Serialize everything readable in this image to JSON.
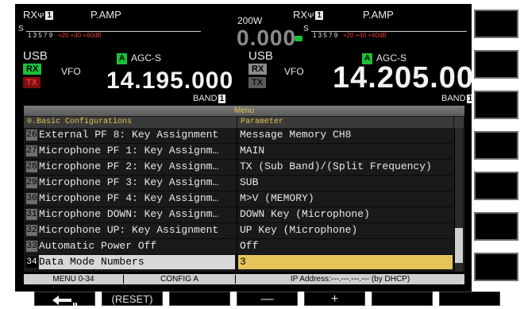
{
  "main": {
    "rx_label": "RX",
    "rx_num": "1",
    "pamp": "P.AMP",
    "s_label": "S",
    "scale_nums": "1  3  5  7  9",
    "scale_red": "+20  +40 +60dB",
    "mode": "USB",
    "rx_badge": "RX",
    "tx_badge": "TX",
    "vfo": "VFO",
    "agc_letter": "A",
    "agc": "AGC-S",
    "frequency": "14.195.000",
    "band_label": "BAND",
    "band_num": "1"
  },
  "sub": {
    "rx_label": "RX",
    "rx_num": "1",
    "pamp": "P.AMP",
    "s_label": "S",
    "scale_nums": "1  3  5  7  9",
    "scale_red": "+20  +40 +60dB",
    "mode": "USB",
    "rx_badge": "RX",
    "tx_badge": "TX",
    "vfo": "VFO",
    "agc_letter": "A",
    "agc": "AGC-S",
    "frequency": "14.205.000",
    "band_label": "BAND",
    "band_num": "1"
  },
  "power": {
    "watts": "200W",
    "meter": "0.000"
  },
  "menu": {
    "title": "Menu",
    "group_header": "0.Basic Configurations",
    "param_header": "Parameter",
    "rows": [
      {
        "num": "26",
        "name": "External PF 8: Key Assignment",
        "param": "Message Memory CH8"
      },
      {
        "num": "27",
        "name": "Microphone PF 1: Key Assignm…",
        "param": "MAIN"
      },
      {
        "num": "28",
        "name": "Microphone PF 2: Key Assignm…",
        "param": "TX (Sub Band)/(Split Frequency)"
      },
      {
        "num": "29",
        "name": "Microphone PF 3: Key Assignm…",
        "param": "SUB"
      },
      {
        "num": "30",
        "name": "Microphone PF 4: Key Assignm…",
        "param": "M>V (MEMORY)"
      },
      {
        "num": "31",
        "name": "Microphone DOWN: Key Assignm…",
        "param": "DOWN Key (Microphone)"
      },
      {
        "num": "32",
        "name": "Microphone UP: Key Assignment",
        "param": "UP Key (Microphone)"
      },
      {
        "num": "33",
        "name": "Automatic Power Off",
        "param": "Off"
      },
      {
        "num": "34",
        "name": "Data Mode Numbers",
        "param": "3"
      }
    ],
    "scroll_position": 0.92
  },
  "status": {
    "menu_id": "MENU 0-34",
    "config": "CONFIG A",
    "ip": "IP Address:---.---.---.--- (by DHCP)"
  },
  "function_keys": {
    "back_icon": "return-arrow-icon",
    "reset": "(RESET)",
    "minus": "—",
    "plus": "+"
  },
  "colors": {
    "rx_green": "#19c03a",
    "tx_red": "#e33333",
    "menu_highlight": "#e6c45a",
    "header_gold": "#e0c050"
  }
}
